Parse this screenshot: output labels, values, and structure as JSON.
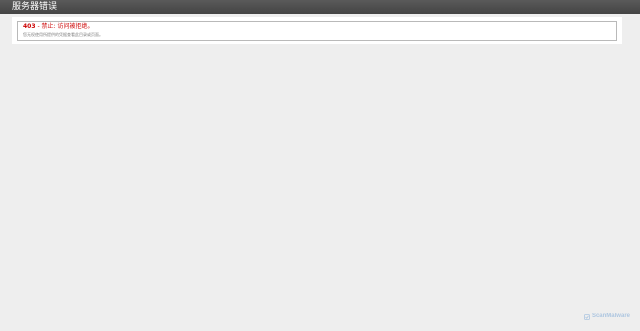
{
  "header": {
    "title": "服务器错误"
  },
  "error": {
    "code": "403",
    "separator": " - ",
    "message": "禁止: 访问被拒绝。",
    "detail": "您无权使用所提供的凭据查看此目录或页面。"
  },
  "watermark": {
    "text": "ScanMalware",
    "icon": "scanmalware-logo-icon"
  },
  "colors": {
    "header_bg": "#4d4d4d",
    "page_bg": "#eeeeee",
    "error_text": "#cc0000",
    "watermark": "#7aa7d6"
  }
}
